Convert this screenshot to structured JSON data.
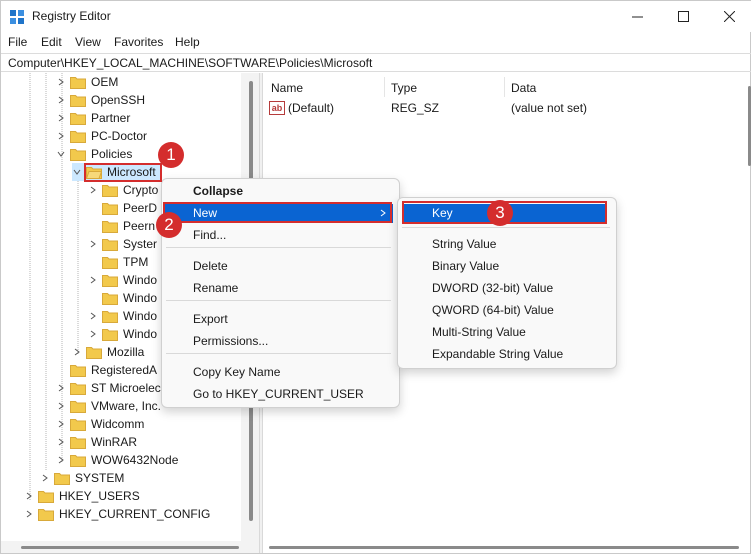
{
  "window": {
    "title": "Registry Editor"
  },
  "menu": [
    "File",
    "Edit",
    "View",
    "Favorites",
    "Help"
  ],
  "address": "Computer\\HKEY_LOCAL_MACHINE\\SOFTWARE\\Policies\\Microsoft",
  "tree": {
    "items": [
      {
        "label": "OEM"
      },
      {
        "label": "OpenSSH"
      },
      {
        "label": "Partner"
      },
      {
        "label": "PC-Doctor"
      },
      {
        "label": "Policies"
      },
      {
        "label": "Microsoft"
      },
      {
        "label": "Crypto"
      },
      {
        "label": "PeerD"
      },
      {
        "label": "Peern"
      },
      {
        "label": "Syster"
      },
      {
        "label": "TPM"
      },
      {
        "label": "Windo"
      },
      {
        "label": "Windo"
      },
      {
        "label": "Windo"
      },
      {
        "label": "Windo"
      },
      {
        "label": "Mozilla"
      },
      {
        "label": "RegisteredA"
      },
      {
        "label": "ST Microelec"
      },
      {
        "label": "VMware, Inc."
      },
      {
        "label": "Widcomm"
      },
      {
        "label": "WinRAR"
      },
      {
        "label": "WOW6432Node"
      },
      {
        "label": "SYSTEM"
      },
      {
        "label": "HKEY_USERS"
      },
      {
        "label": "HKEY_CURRENT_CONFIG"
      }
    ]
  },
  "list": {
    "columns": [
      "Name",
      "Type",
      "Data"
    ],
    "rows": [
      {
        "name": "(Default)",
        "type": "REG_SZ",
        "data": "(value not set)"
      }
    ]
  },
  "context_menu": {
    "items": [
      "Collapse",
      "New",
      "Find...",
      "Delete",
      "Rename",
      "Export",
      "Permissions...",
      "Copy Key Name",
      "Go to HKEY_CURRENT_USER"
    ]
  },
  "submenu": {
    "items": [
      "Key",
      "String Value",
      "Binary Value",
      "DWORD (32-bit) Value",
      "QWORD (64-bit) Value",
      "Multi-String Value",
      "Expandable String Value"
    ]
  },
  "badges": [
    "1",
    "2",
    "3"
  ],
  "colors": {
    "highlight": "#0a64d2",
    "annotation": "#d42d2d",
    "folder": "#f2c94c"
  }
}
